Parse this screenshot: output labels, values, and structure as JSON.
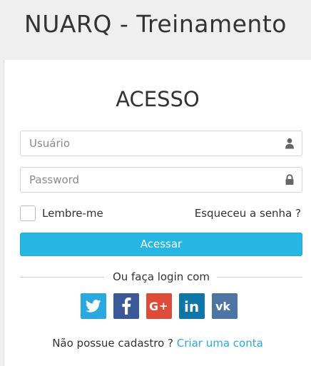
{
  "header": {
    "title": "NUARQ - Treinamento"
  },
  "card": {
    "title": "ACESSO"
  },
  "form": {
    "username_placeholder": "Usuário",
    "username_value": "",
    "password_placeholder": "Password",
    "password_value": "",
    "remember_label": "Lembre-me",
    "remember_checked": false,
    "forgot_label": "Esqueceu a senha ?",
    "submit_label": "Acessar"
  },
  "social": {
    "divider_text": "Ou faça login com",
    "providers": [
      {
        "icon": "twitter-icon",
        "color": "#2aa9e0"
      },
      {
        "icon": "facebook-icon",
        "color": "#3b5998"
      },
      {
        "icon": "google-plus-icon",
        "color": "#dd4b39"
      },
      {
        "icon": "linkedin-icon",
        "color": "#0e76a8"
      },
      {
        "icon": "vk-icon",
        "color": "#4c75a3"
      }
    ]
  },
  "signup": {
    "prompt": "Não possue cadastro ?",
    "link_label": "Criar uma conta"
  },
  "colors": {
    "accent": "#27b6e4",
    "link": "#2aa9e0",
    "background": "#efefef"
  }
}
